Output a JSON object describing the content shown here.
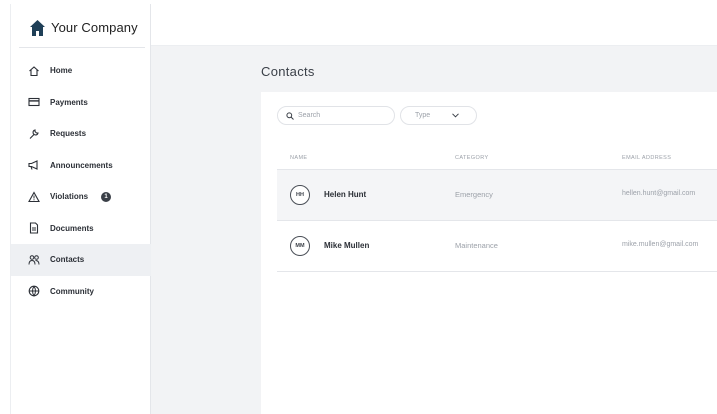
{
  "brand": {
    "name": "Your Company",
    "icon": "house-icon"
  },
  "sidebar": {
    "items": [
      {
        "label": "Home",
        "icon": "home-icon"
      },
      {
        "label": "Payments",
        "icon": "credit-card-icon"
      },
      {
        "label": "Requests",
        "icon": "wrench-icon"
      },
      {
        "label": "Announcements",
        "icon": "megaphone-icon"
      },
      {
        "label": "Violations",
        "icon": "warning-icon",
        "badge": "1"
      },
      {
        "label": "Documents",
        "icon": "document-icon"
      },
      {
        "label": "Contacts",
        "icon": "people-icon",
        "active": true
      },
      {
        "label": "Community",
        "icon": "globe-icon"
      }
    ]
  },
  "page": {
    "title": "Contacts"
  },
  "filters": {
    "search_placeholder": "Search",
    "type_label": "Type"
  },
  "table": {
    "columns": [
      "NAME",
      "CATEGORY",
      "EMAIL ADDRESS"
    ],
    "rows": [
      {
        "initials": "HH",
        "name": "Helen Hunt",
        "category": "Emergency",
        "email": "hellen.hunt@gmail.com"
      },
      {
        "initials": "MM",
        "name": "Mike Mullen",
        "category": "Maintenance",
        "email": "mike.mullen@gmail.com"
      }
    ]
  },
  "colors": {
    "background": "#f2f3f5",
    "active_nav": "#eef0f3",
    "brand_icon": "#1f3f57",
    "text": "#2b2f36"
  }
}
